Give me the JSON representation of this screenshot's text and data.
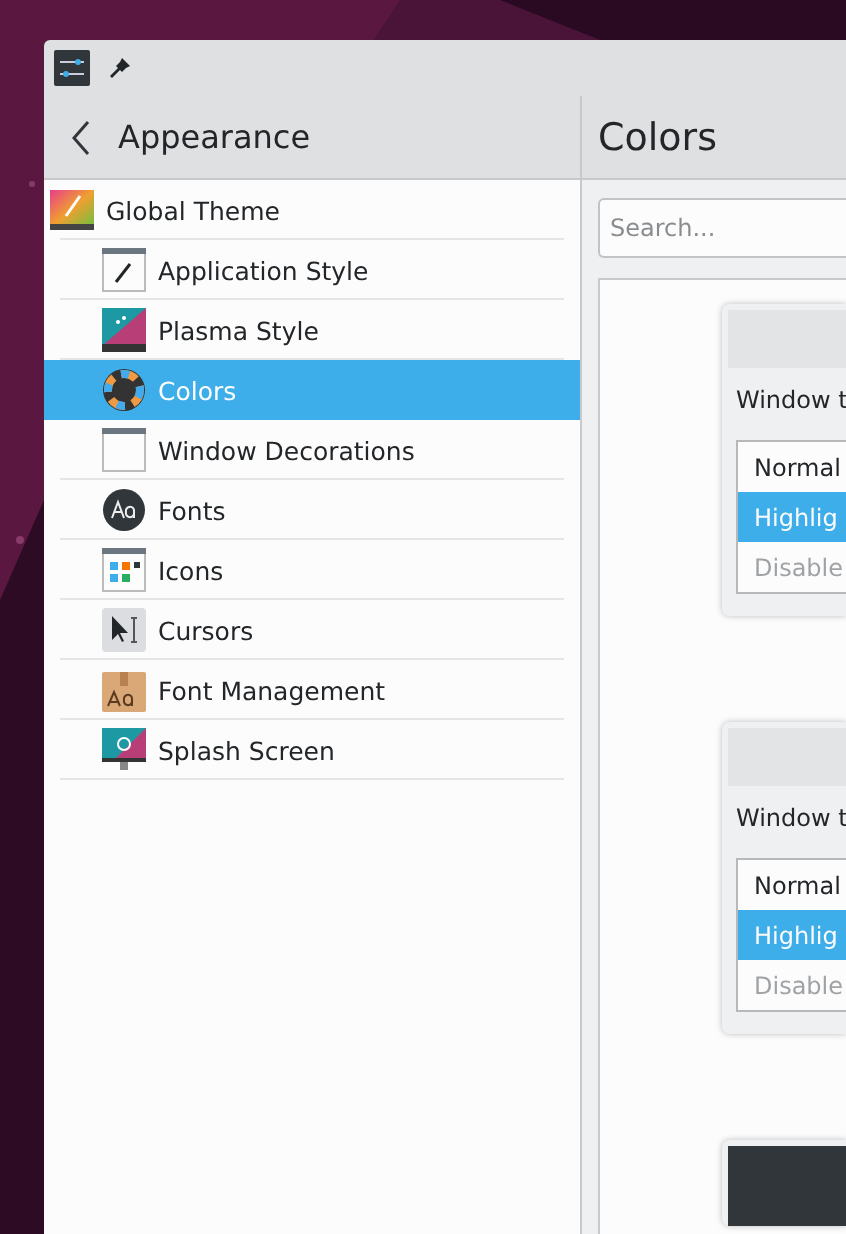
{
  "sidebar": {
    "title": "Appearance",
    "items": [
      {
        "label": "Global Theme",
        "selected": false,
        "children": [
          {
            "label": "Application Style",
            "selected": false
          },
          {
            "label": "Plasma Style",
            "selected": false
          },
          {
            "label": "Colors",
            "selected": true
          },
          {
            "label": "Window Decorations",
            "selected": false
          },
          {
            "label": "Fonts",
            "selected": false
          },
          {
            "label": "Icons",
            "selected": false
          },
          {
            "label": "Cursors",
            "selected": false
          },
          {
            "label": "Font Management",
            "selected": false
          },
          {
            "label": "Splash Screen",
            "selected": false
          }
        ]
      }
    ]
  },
  "page": {
    "title": "Colors",
    "search": {
      "placeholder": "Search..."
    },
    "schemes": [
      {
        "kind": "light",
        "label": "Window t",
        "rows": [
          {
            "kind": "normal",
            "text": "Normal"
          },
          {
            "kind": "highlight",
            "text": "Highlig"
          },
          {
            "kind": "disabled",
            "text": "Disable"
          }
        ]
      },
      {
        "kind": "light",
        "label": "Window t",
        "rows": [
          {
            "kind": "normal",
            "text": "Normal"
          },
          {
            "kind": "highlight",
            "text": "Highlig"
          },
          {
            "kind": "disabled",
            "text": "Disable"
          }
        ]
      },
      {
        "kind": "dark"
      }
    ]
  }
}
